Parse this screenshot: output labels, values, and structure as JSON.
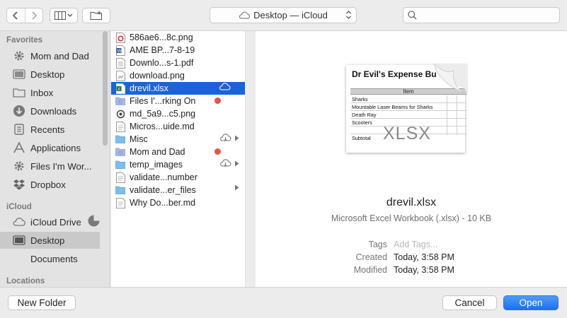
{
  "toolbar": {
    "location_label": "Desktop — iCloud",
    "search_placeholder": ""
  },
  "sidebar": {
    "favorites_title": "Favorites",
    "favorites": [
      {
        "label": "Mom and Dad",
        "icon": "gear-folder-icon"
      },
      {
        "label": "Desktop",
        "icon": "desktop-icon"
      },
      {
        "label": "Inbox",
        "icon": "folder-icon"
      },
      {
        "label": "Downloads",
        "icon": "downloads-icon"
      },
      {
        "label": "Recents",
        "icon": "recents-icon"
      },
      {
        "label": "Applications",
        "icon": "applications-icon"
      },
      {
        "label": "Files I'm Wor...",
        "icon": "gear-folder-icon"
      },
      {
        "label": "Dropbox",
        "icon": "dropbox-icon"
      }
    ],
    "icloud_title": "iCloud",
    "icloud": [
      {
        "label": "iCloud Drive",
        "icon": "cloud-icon"
      },
      {
        "label": "Desktop",
        "icon": "desktop-icon"
      },
      {
        "label": "Documents",
        "icon": "documents-icon"
      }
    ],
    "locations_title": "Locations",
    "selected": "Desktop (iCloud)"
  },
  "files": [
    {
      "name": "586ae6...8c.png",
      "icon": "image-file-icon"
    },
    {
      "name": "AME BP...7-8-19",
      "icon": "word-file-icon"
    },
    {
      "name": "Downlo...s-1.pdf",
      "icon": "pdf-file-icon"
    },
    {
      "name": "download.png",
      "icon": "image-file-icon"
    },
    {
      "name": "drevil.xlsx",
      "icon": "excel-file-icon",
      "selected": true,
      "cloud": true
    },
    {
      "name": "Files I'...rking On",
      "icon": "folder-icon",
      "tag_color": "#e5534b"
    },
    {
      "name": "md_5a9...c5.png",
      "icon": "image-file-icon"
    },
    {
      "name": "Micros...uide.md",
      "icon": "text-file-icon"
    },
    {
      "name": "Misc",
      "icon": "folder-icon",
      "cloud": true,
      "arrow": true
    },
    {
      "name": "Mom and Dad",
      "icon": "folder-icon",
      "tag_color": "#e5534b"
    },
    {
      "name": "temp_images",
      "icon": "folder-icon",
      "cloud": true,
      "arrow": true
    },
    {
      "name": "validate...number",
      "icon": "text-file-icon"
    },
    {
      "name": "validate...er_files",
      "icon": "folder-icon",
      "arrow": true
    },
    {
      "name": "Why Do...ber.md",
      "icon": "text-file-icon"
    }
  ],
  "preview": {
    "thumbnail": {
      "title": "Dr Evil's Expense Budg",
      "header": "Item",
      "rows": [
        "Sharks",
        "Mountable Laser Beams for Sharks",
        "Death Ray",
        "Scooters",
        "",
        "Subtotal"
      ],
      "extension": "XLSX"
    },
    "name": "drevil.xlsx",
    "kind": "Microsoft Excel Workbook (.xlsx) - 10 KB",
    "tags_label": "Tags",
    "tags_placeholder": "Add Tags...",
    "created_label": "Created",
    "created_value": "Today, 3:58 PM",
    "modified_label": "Modified",
    "modified_value": "Today, 3:58 PM"
  },
  "buttons": {
    "new_folder": "New Folder",
    "cancel": "Cancel",
    "open": "Open"
  },
  "colors": {
    "accent": "#1a64d8",
    "tag_red": "#e5534b",
    "sidebar_selected": "#c9c9c9"
  }
}
